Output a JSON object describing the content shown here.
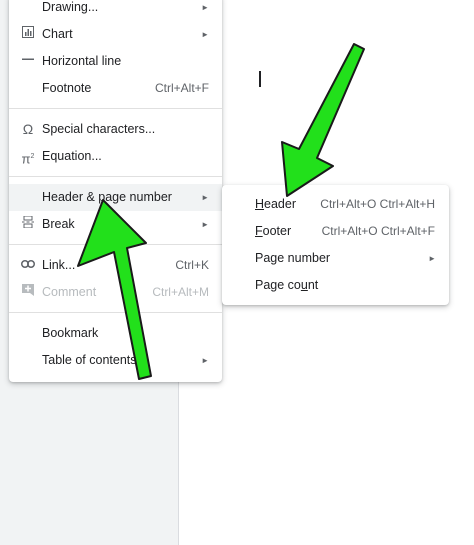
{
  "menu": {
    "items": [
      {
        "label": "Drawing...",
        "arrow": "►"
      },
      {
        "label": "Chart",
        "arrow": "►"
      },
      {
        "label": "Horizontal line"
      },
      {
        "label": "Footnote",
        "shortcut": "Ctrl+Alt+F"
      },
      {
        "label": "Special characters..."
      },
      {
        "label": "Equation..."
      },
      {
        "label": "Header & page number",
        "arrow": "►"
      },
      {
        "label": "Break",
        "arrow": "►"
      },
      {
        "label": "Link...",
        "shortcut": "Ctrl+K"
      },
      {
        "label": "Comment",
        "shortcut": "Ctrl+Alt+M"
      },
      {
        "label": "Bookmark"
      },
      {
        "label": "Table of contents",
        "arrow": "►"
      }
    ]
  },
  "submenu": {
    "items": [
      {
        "first": "H",
        "rest": "eader",
        "shortcut": "Ctrl+Alt+O Ctrl+Alt+H"
      },
      {
        "first": "F",
        "rest": "ooter",
        "shortcut": "Ctrl+Alt+O Ctrl+Alt+F"
      },
      {
        "pre": "Pa",
        "u": "g",
        "post": "e number",
        "arrow": "►"
      },
      {
        "pre": "Page co",
        "u": "u",
        "post": "nt"
      }
    ]
  },
  "icons": {
    "chart": "bar-chart-icon",
    "horizontal_line": "horizontal-line-icon",
    "special_characters": "omega-icon",
    "equation": "pi-squared-icon",
    "break": "page-break-icon",
    "link": "link-icon",
    "comment": "add-comment-icon"
  },
  "colors": {
    "arrow_fill": "#22e01b",
    "arrow_stroke": "#1a1a1a",
    "highlight": "#f1f3f4",
    "disabled_text": "#b7bbbe"
  }
}
